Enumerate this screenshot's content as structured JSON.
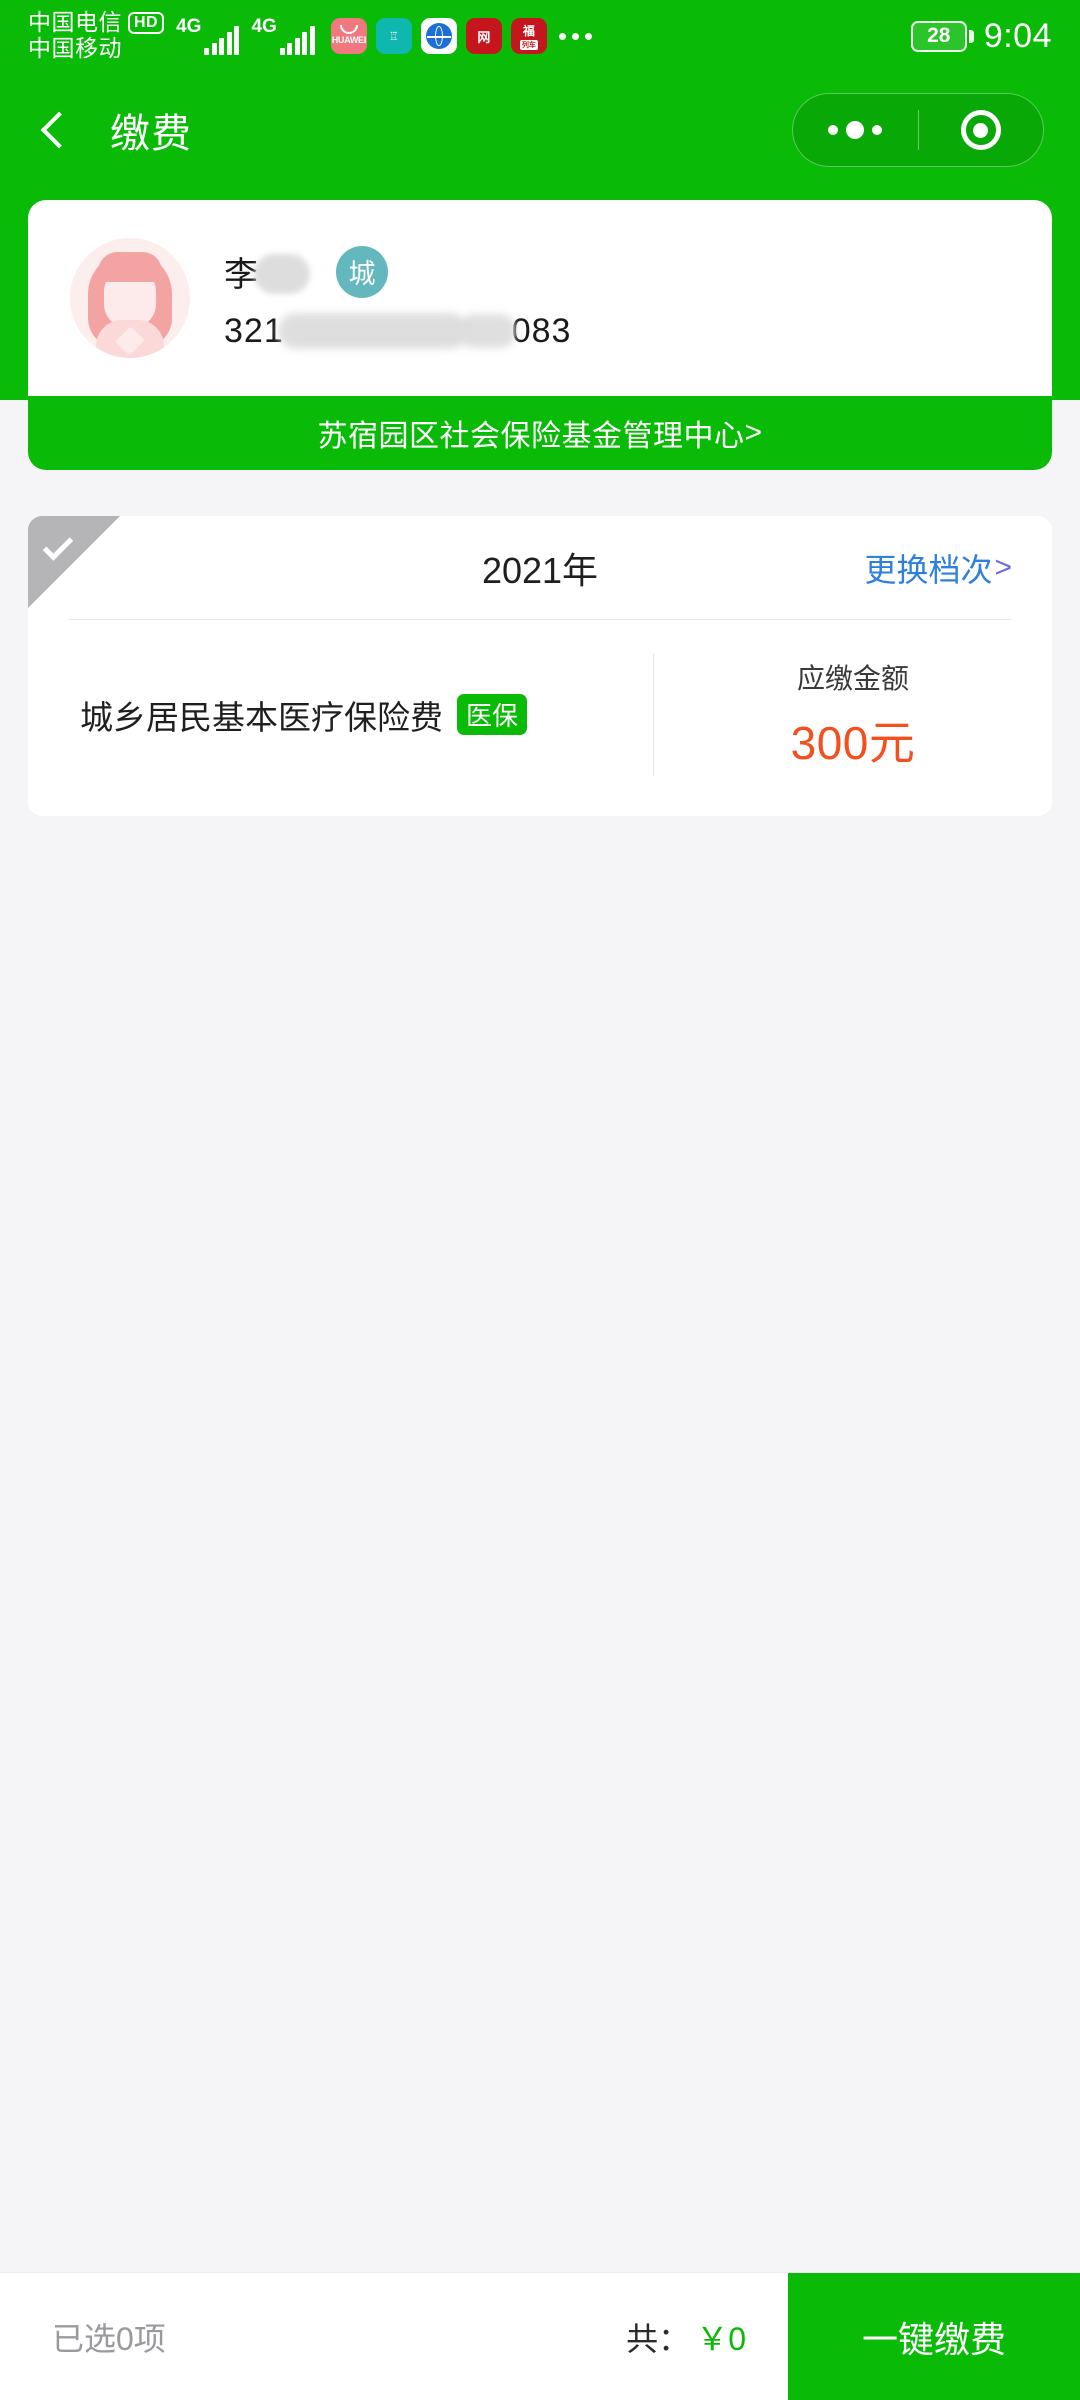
{
  "status_bar": {
    "carriers": [
      "中国电信",
      "中国移动"
    ],
    "hd_label": "HD",
    "network_1": "4G",
    "network_2": "4G",
    "notification_icons": [
      "huawei-icon",
      "mi-icon",
      "globe-icon",
      "red-app-icon",
      "red-coupon-icon"
    ],
    "overflow_label": "•••",
    "battery_level": "28",
    "time": "9:04"
  },
  "nav": {
    "back_icon": "back-chevron-icon",
    "title": "缴费",
    "capsule": {
      "more_icon": "more-dots-icon",
      "close_icon": "target-circle-icon"
    }
  },
  "user_card": {
    "avatar": "female-avatar-icon",
    "name": "李",
    "name_redacted": true,
    "type_badge": "城",
    "id_prefix": "321",
    "id_suffix": "083",
    "id_redacted": true
  },
  "org_bar": {
    "label": "苏宿园区社会保险基金管理中心",
    "chevron": ">"
  },
  "payment_item": {
    "selected": false,
    "check_icon": "check-icon",
    "year": "2021年",
    "change_tier_label": "更换档次",
    "change_tier_chevron": ">",
    "fee_name": "城乡居民基本医疗保险费",
    "fee_badge": "医保",
    "amount_label": "应缴金额",
    "amount_value": "300元"
  },
  "bottom_bar": {
    "selected_count_label": "已选0项",
    "total_label": "共：",
    "total_value": "￥0",
    "pay_button_label": "一键缴费"
  },
  "colors": {
    "brand_green": "#09BB07",
    "amount_red": "#F4501E",
    "link_blue": "#2d7fe0",
    "badge_teal": "#63B8BE",
    "page_bg": "#F5F5F8"
  }
}
